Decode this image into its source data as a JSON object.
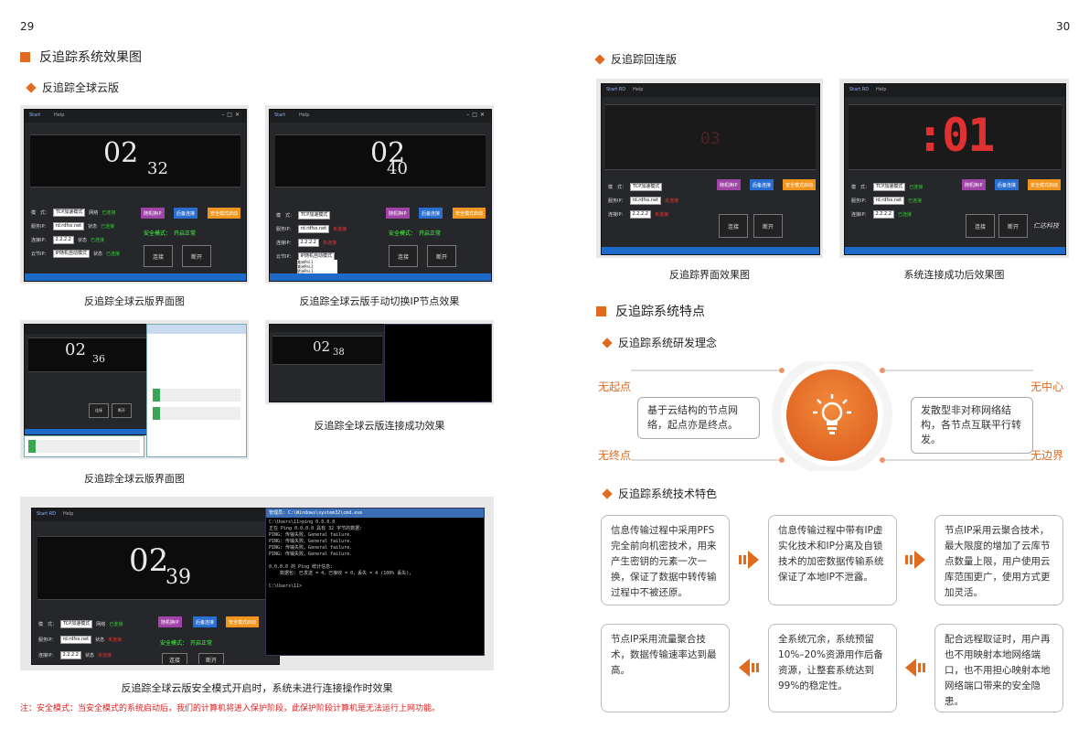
{
  "pages": {
    "left": "29",
    "right": "30"
  },
  "left": {
    "section_title": "反追踪系统效果图",
    "sub_title": "反追踪全球云版",
    "captions": [
      "反追踪全球云版界面图",
      "反追踪全球云版手动切换IP节点效果",
      "反追踪全球云版界面图",
      "反追踪全球云版连接成功效果",
      "反追踪全球云版安全模式开启时，系统未进行连接操作时效果"
    ],
    "note": "注：安全模式：当安全模式的系统启动后，我们的计算机将进入保护阶段，此保护阶段计算机是无法运行上网功能。"
  },
  "app": {
    "tab_start": "Start",
    "tab_start_rd": "Start RD",
    "tab_help": "Help",
    "mode_label": "模　式：",
    "mode_value": "TCP加速模式",
    "server_label": "服务IP：",
    "server_value": "rd.rdfss.net",
    "proxy_label": "连接IP：",
    "proxy_value": "2.2.2.2",
    "cloud_label": "云节IP：",
    "cloud_value": "IP随机自动模式",
    "net_label": "网络",
    "status_label": "状态",
    "status_ok": "已连接",
    "status_bad": "未连接",
    "btn_purple": "随机换IP",
    "btn_blue": "后备连接",
    "btn_orange": "安全模式启动",
    "safe_mode": "安全模式：　开启正常",
    "connect": "连接",
    "disconnect": "断开",
    "clocks": [
      "02",
      "32",
      "02",
      "40",
      "02",
      "36",
      "02",
      "38",
      "02",
      "39"
    ],
    "dropdown": [
      "美洲Pal.1",
      "美洲Pal.2",
      "欧洲Pal.1",
      "日本Pal.1",
      "加拿Pal.1"
    ]
  },
  "cmd": {
    "title": "管理员: C:\\Windows\\system32\\cmd.exe",
    "lines": [
      "C:\\Users\\11>ping 0.0.0.0",
      "",
      "正在 Ping 0.0.0.0 具有 32 字节的数据:",
      "PING: 传输失败。General failure.",
      "PING: 传输失败。General failure.",
      "PING: 传输失败。General failure.",
      "PING: 传输失败。General failure.",
      "",
      "0.0.0.0 的 Ping 统计信息:",
      "    数据包: 已发送 = 4，已接收 = 0，丢失 = 4 (100% 丢失)，",
      "",
      "C:\\Users\\11>"
    ]
  },
  "right": {
    "sub_title_reconnect": "反追踪回连版",
    "captions": [
      "反追踪界面效果图",
      "系统连接成功后效果图"
    ],
    "rd_digits_dim": "03",
    "rd_digits_big": ":01",
    "brand": "仁达科技",
    "section_title": "反追踪系统特点",
    "concept_title": "反追踪系统研发理念",
    "nodes": {
      "tl": "无起点",
      "tr": "无中心",
      "bl": "无终点",
      "br": "无边界"
    },
    "bubble_left": "基于云结构的节点网络，起点亦是终点。",
    "bubble_right": "发散型非对称网络结构，各节点互联平行转发。",
    "tech_title": "反追踪系统技术特色",
    "features": [
      "信息传输过程中采用PFS完全前向机密技术，用来产生密钥的元素一次一换，保证了数据中转传输过程中不被还原。",
      "信息传输过程中带有IP虚实化技术和IP分离及自锁技术的加密数据传输系统保证了本地IP不泄露。",
      "节点IP采用云聚合技术，最大限度的增加了云库节点数量上限，用户使用云库范围更广，使用方式更加灵活。",
      "节点IP采用流量聚合技术，数据传输速率达到最高。",
      "全系统冗余，系统预留10%–20%资源用作后备资源，让整套系统达到99%的稳定性。",
      "配合远程取证时，用户再也不用映射本地网络端口，也不用担心映射本地网络端口带来的安全隐患。"
    ]
  },
  "colors": {
    "accent": "#e06a1e",
    "note_red": "#e02020"
  }
}
